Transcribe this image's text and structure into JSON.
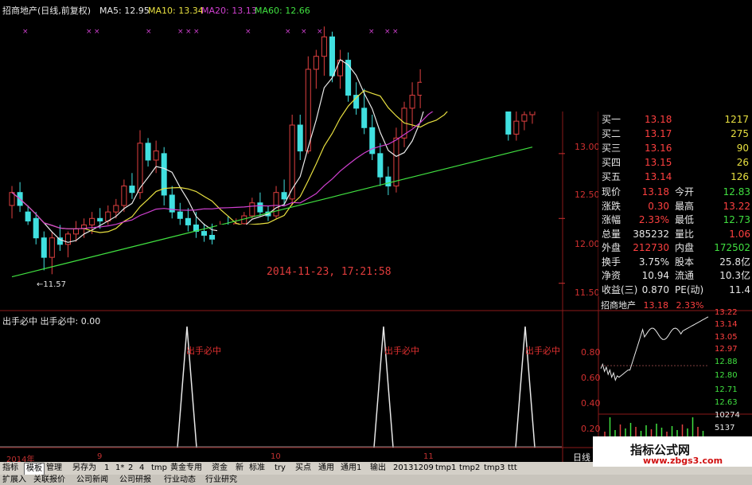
{
  "header": {
    "title": "招商地产(日线,前复权)",
    "ma5": "MA5: 12.95",
    "ma10": "MA10: 13.34",
    "ma20": "MA20: 13.13",
    "ma60": "MA60: 12.66"
  },
  "price_axis": [
    "13.00",
    "12.50",
    "12.00",
    "11.50"
  ],
  "low_label": "←11.57",
  "timestamp": "2014-11-23, 17:21:58",
  "indicator": {
    "header": "出手必中  出手必中: 0.00",
    "signal": "出手必中",
    "ticks": [
      "0.80",
      "0.60",
      "0.40",
      "0.20"
    ]
  },
  "date_axis": {
    "year": "2014年",
    "m9": "9",
    "m10": "10",
    "m11": "11"
  },
  "daily_label": "日线",
  "quote": {
    "bids": [
      {
        "label": "买一",
        "price": "13.18",
        "vol": "1217"
      },
      {
        "label": "买二",
        "price": "13.17",
        "vol": "275"
      },
      {
        "label": "买三",
        "price": "13.16",
        "vol": "90"
      },
      {
        "label": "买四",
        "price": "13.15",
        "vol": "26"
      },
      {
        "label": "买五",
        "price": "13.14",
        "vol": "126"
      }
    ],
    "stats": [
      {
        "l1": "现价",
        "v1": "13.18",
        "l2": "今开",
        "v2": "12.83"
      },
      {
        "l1": "涨跌",
        "v1": "0.30",
        "l2": "最高",
        "v2": "13.22"
      },
      {
        "l1": "涨幅",
        "v1": "2.33%",
        "l2": "最低",
        "v2": "12.73"
      },
      {
        "l1": "总量",
        "v1": "385232",
        "l2": "量比",
        "v2": "1.06"
      },
      {
        "l1": "外盘",
        "v1": "212730",
        "l2": "内盘",
        "v2": "172502"
      },
      {
        "l1": "换手",
        "v1": "3.75%",
        "l2": "股本",
        "v2": "25.8亿"
      },
      {
        "l1": "净资",
        "v1": "10.94",
        "l2": "流通",
        "v2": "10.3亿"
      },
      {
        "l1": "收益(三)",
        "v1": "0.870",
        "l2": "PE(动)",
        "v2": "11.4"
      }
    ]
  },
  "mini_chart": {
    "name": "招商地产",
    "price": "13.18",
    "pct": "2.33%",
    "ticks": [
      "13.22",
      "13.14",
      "13.05",
      "12.97",
      "12.88",
      "12.80",
      "12.71",
      "12.63",
      "10274",
      "5137"
    ]
  },
  "tabs": [
    "指标",
    "模板",
    "管理",
    "另存为",
    "1",
    "1*",
    "2",
    "4",
    "tmp",
    "黄金专用",
    "资金",
    "新",
    "标准",
    "try",
    "买点",
    "通用",
    "通用1",
    "输出",
    "20131209",
    "tmp1",
    "tmp2",
    "tmp3",
    "ttt"
  ],
  "tabs2": [
    "扩展入",
    "关联报价",
    "公司新闻",
    "公司研报",
    "行业动态",
    "行业研究"
  ],
  "watermark": {
    "title": "指标公式网",
    "url": "www.zbgs3.com"
  },
  "chart_data": {
    "type": "candlestick",
    "title": "招商地产(日线,前复权)",
    "ylim": [
      11.4,
      13.5
    ],
    "candles": [
      {
        "o": 12.1,
        "h": 12.25,
        "l": 12.0,
        "c": 12.2
      },
      {
        "o": 12.2,
        "h": 12.28,
        "l": 12.05,
        "c": 12.1
      },
      {
        "o": 12.05,
        "h": 12.1,
        "l": 11.95,
        "c": 11.98
      },
      {
        "o": 12.0,
        "h": 12.05,
        "l": 11.8,
        "c": 11.85
      },
      {
        "o": 11.85,
        "h": 11.9,
        "l": 11.6,
        "c": 11.7
      },
      {
        "o": 11.7,
        "h": 11.9,
        "l": 11.57,
        "c": 11.85
      },
      {
        "o": 11.85,
        "h": 11.95,
        "l": 11.75,
        "c": 11.8
      },
      {
        "o": 11.8,
        "h": 11.9,
        "l": 11.7,
        "c": 11.88
      },
      {
        "o": 11.88,
        "h": 11.98,
        "l": 11.82,
        "c": 11.92
      },
      {
        "o": 11.92,
        "h": 12.0,
        "l": 11.85,
        "c": 11.95
      },
      {
        "o": 11.95,
        "h": 12.05,
        "l": 11.88,
        "c": 12.0
      },
      {
        "o": 12.0,
        "h": 12.08,
        "l": 11.92,
        "c": 11.98
      },
      {
        "o": 11.98,
        "h": 12.1,
        "l": 11.95,
        "c": 12.05
      },
      {
        "o": 12.05,
        "h": 12.15,
        "l": 12.0,
        "c": 12.1
      },
      {
        "o": 12.1,
        "h": 12.3,
        "l": 12.05,
        "c": 12.25
      },
      {
        "o": 12.25,
        "h": 12.35,
        "l": 12.15,
        "c": 12.2
      },
      {
        "o": 12.2,
        "h": 12.68,
        "l": 12.15,
        "c": 12.58
      },
      {
        "o": 12.58,
        "h": 12.62,
        "l": 12.4,
        "c": 12.45
      },
      {
        "o": 12.45,
        "h": 12.6,
        "l": 12.35,
        "c": 12.52
      },
      {
        "o": 12.5,
        "h": 12.55,
        "l": 12.1,
        "c": 12.18
      },
      {
        "o": 12.18,
        "h": 12.25,
        "l": 12.0,
        "c": 12.05
      },
      {
        "o": 12.05,
        "h": 12.12,
        "l": 11.95,
        "c": 12.0
      },
      {
        "o": 12.0,
        "h": 12.08,
        "l": 11.9,
        "c": 11.95
      },
      {
        "o": 11.95,
        "h": 12.05,
        "l": 11.85,
        "c": 11.9
      },
      {
        "o": 11.9,
        "h": 11.96,
        "l": 11.82,
        "c": 11.87
      },
      {
        "o": 11.87,
        "h": 11.96,
        "l": 11.8,
        "c": 11.84
      },
      {
        "o": 11.84,
        "h": 11.98,
        "l": 11.82,
        "c": 11.95
      },
      {
        "o": 11.95,
        "h": 12.02,
        "l": 11.88,
        "c": 11.92
      },
      {
        "o": 11.92,
        "h": 12.0,
        "l": 11.86,
        "c": 11.96
      },
      {
        "o": 11.96,
        "h": 12.05,
        "l": 11.92,
        "c": 12.02
      },
      {
        "o": 12.02,
        "h": 12.16,
        "l": 12.0,
        "c": 12.12
      },
      {
        "o": 12.12,
        "h": 12.2,
        "l": 12.02,
        "c": 12.05
      },
      {
        "o": 12.05,
        "h": 12.1,
        "l": 11.98,
        "c": 12.02
      },
      {
        "o": 12.02,
        "h": 12.25,
        "l": 12.0,
        "c": 12.2
      },
      {
        "o": 12.2,
        "h": 12.3,
        "l": 12.1,
        "c": 12.15
      },
      {
        "o": 12.15,
        "h": 12.8,
        "l": 12.1,
        "c": 12.72
      },
      {
        "o": 12.72,
        "h": 12.8,
        "l": 12.45,
        "c": 12.52
      },
      {
        "o": 12.52,
        "h": 13.25,
        "l": 12.5,
        "c": 13.15
      },
      {
        "o": 13.15,
        "h": 13.3,
        "l": 13.0,
        "c": 13.25
      },
      {
        "o": 13.25,
        "h": 13.48,
        "l": 13.1,
        "c": 13.4
      },
      {
        "o": 13.4,
        "h": 13.44,
        "l": 13.05,
        "c": 13.1
      },
      {
        "o": 13.1,
        "h": 13.3,
        "l": 13.0,
        "c": 13.22
      },
      {
        "o": 13.22,
        "h": 13.28,
        "l": 12.9,
        "c": 12.95
      },
      {
        "o": 12.95,
        "h": 13.05,
        "l": 12.8,
        "c": 12.85
      },
      {
        "o": 12.85,
        "h": 13.0,
        "l": 12.65,
        "c": 12.7
      },
      {
        "o": 12.7,
        "h": 12.8,
        "l": 12.45,
        "c": 12.5
      },
      {
        "o": 12.5,
        "h": 12.58,
        "l": 12.25,
        "c": 12.32
      },
      {
        "o": 12.32,
        "h": 12.4,
        "l": 12.18,
        "c": 12.25
      },
      {
        "o": 12.25,
        "h": 12.7,
        "l": 12.2,
        "c": 12.62
      },
      {
        "o": 12.62,
        "h": 12.9,
        "l": 12.55,
        "c": 12.85
      },
      {
        "o": 12.85,
        "h": 13.05,
        "l": 12.7,
        "c": 12.95
      },
      {
        "o": 12.95,
        "h": 13.15,
        "l": 12.85,
        "c": 13.05
      },
      {
        "o": 13.05,
        "h": 13.38,
        "l": 12.98,
        "c": 13.28
      },
      {
        "o": 13.28,
        "h": 13.32,
        "l": 13.0,
        "c": 13.05
      },
      {
        "o": 13.05,
        "h": 13.2,
        "l": 12.95,
        "c": 13.12
      },
      {
        "o": 13.12,
        "h": 13.3,
        "l": 13.05,
        "c": 13.2
      },
      {
        "o": 13.2,
        "h": 13.38,
        "l": 13.1,
        "c": 13.3
      },
      {
        "o": 13.3,
        "h": 13.4,
        "l": 13.15,
        "c": 13.22
      },
      {
        "o": 13.22,
        "h": 13.35,
        "l": 13.1,
        "c": 13.28
      },
      {
        "o": 13.28,
        "h": 13.3,
        "l": 13.2,
        "c": 13.25
      },
      {
        "o": 13.25,
        "h": 13.3,
        "l": 13.15,
        "c": 13.2
      },
      {
        "o": 13.2,
        "h": 13.25,
        "l": 12.98,
        "c": 13.0
      },
      {
        "o": 13.0,
        "h": 13.05,
        "l": 12.6,
        "c": 12.65
      },
      {
        "o": 12.65,
        "h": 12.9,
        "l": 12.6,
        "c": 12.75
      },
      {
        "o": 12.75,
        "h": 12.88,
        "l": 12.68,
        "c": 12.8
      },
      {
        "o": 12.8,
        "h": 13.22,
        "l": 12.73,
        "c": 13.18
      }
    ],
    "signal_days": [
      33,
      48,
      63
    ],
    "indicator_ylim": [
      0,
      1
    ]
  },
  "colors": {
    "up": "#e04040",
    "down": "#40e0e0",
    "ma5": "#e8e8e8",
    "ma10": "#e8e040",
    "ma20": "#d040d0",
    "ma60": "#40e040",
    "grid": "#8b1a1a",
    "signal": "#e8e8e8"
  }
}
